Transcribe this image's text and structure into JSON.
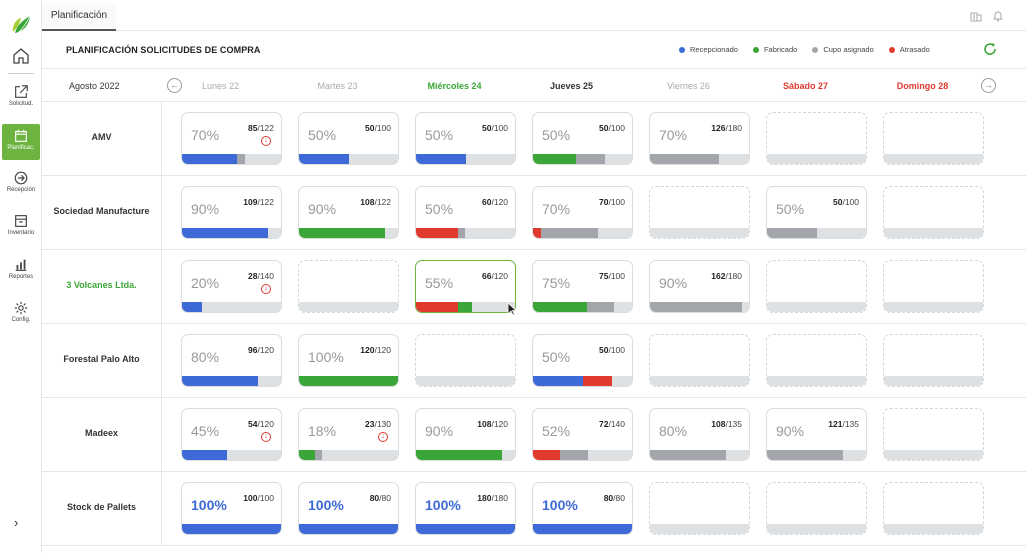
{
  "tab": "Planificación",
  "title": "PLANIFICACIÓN SOLICITUDES DE COMPRA",
  "legend": [
    {
      "label": "Recepcionado",
      "color": "#3d6ad6"
    },
    {
      "label": "Fabricado",
      "color": "#3aa637"
    },
    {
      "label": "Cupo asignado",
      "color": "#a2a6aa"
    },
    {
      "label": "Atrasado",
      "color": "#e03a2e"
    }
  ],
  "sidebar": [
    {
      "label": "Solicitud.",
      "icon": "external-link-icon",
      "active": false
    },
    {
      "label": "Planificac.",
      "icon": "calendar-icon",
      "active": true
    },
    {
      "label": "Recepción",
      "icon": "arrow-circle-icon",
      "active": false
    },
    {
      "label": "Inventario",
      "icon": "box-icon",
      "active": false
    },
    {
      "label": "Reportes",
      "icon": "bar-chart-icon",
      "active": false
    },
    {
      "label": "Config.",
      "icon": "gear-icon",
      "active": false
    }
  ],
  "month": "Agosto 2022",
  "days": [
    {
      "label": "Lunes 22",
      "color": "#aaaaaa",
      "bold": false
    },
    {
      "label": "Martes 23",
      "color": "#aaaaaa",
      "bold": false
    },
    {
      "label": "Miércoles 24",
      "color": "#3aa637",
      "bold": true
    },
    {
      "label": "Jueves 25",
      "color": "#333333",
      "bold": true
    },
    {
      "label": "Viernes 26",
      "color": "#aaaaaa",
      "bold": false
    },
    {
      "label": "Sábado 27",
      "color": "#e03a2e",
      "bold": true
    },
    {
      "label": "Domingo 28",
      "color": "#e03a2e",
      "bold": true
    }
  ],
  "rows": [
    {
      "name": "AMV",
      "highlight": false,
      "cells": [
        {
          "pct": "70%",
          "num": "85",
          "den": "122",
          "alert": true,
          "segs": [
            {
              "c": "blue",
              "w": 0.56
            },
            {
              "c": "gray",
              "w": 0.08
            }
          ]
        },
        {
          "pct": "50%",
          "num": "50",
          "den": "100",
          "alert": false,
          "segs": [
            {
              "c": "blue",
              "w": 0.5
            }
          ]
        },
        {
          "pct": "50%",
          "num": "50",
          "den": "100",
          "alert": false,
          "segs": [
            {
              "c": "blue",
              "w": 0.5
            }
          ]
        },
        {
          "pct": "50%",
          "num": "50",
          "den": "100",
          "alert": false,
          "segs": [
            {
              "c": "green",
              "w": 0.43
            },
            {
              "c": "gray",
              "w": 0.3
            }
          ]
        },
        {
          "pct": "70%",
          "num": "126",
          "den": "180",
          "alert": false,
          "segs": [
            {
              "c": "gray",
              "w": 0.7
            }
          ]
        },
        null,
        null
      ]
    },
    {
      "name": "Sociedad Manufacture",
      "highlight": false,
      "cells": [
        {
          "pct": "90%",
          "num": "109",
          "den": "122",
          "alert": false,
          "segs": [
            {
              "c": "blue",
              "w": 0.87
            }
          ]
        },
        {
          "pct": "90%",
          "num": "108",
          "den": "122",
          "alert": false,
          "segs": [
            {
              "c": "green",
              "w": 0.87
            }
          ]
        },
        {
          "pct": "50%",
          "num": "60",
          "den": "120",
          "alert": false,
          "segs": [
            {
              "c": "red",
              "w": 0.42
            },
            {
              "c": "gray",
              "w": 0.08
            }
          ]
        },
        {
          "pct": "70%",
          "num": "70",
          "den": "100",
          "alert": false,
          "segs": [
            {
              "c": "red",
              "w": 0.08
            },
            {
              "c": "gray",
              "w": 0.58
            }
          ]
        },
        null,
        {
          "pct": "50%",
          "num": "50",
          "den": "100",
          "alert": false,
          "segs": [
            {
              "c": "gray",
              "w": 0.5
            }
          ]
        },
        null
      ]
    },
    {
      "name": "3 Volcanes Ltda.",
      "highlight": true,
      "cells": [
        {
          "pct": "20%",
          "num": "28",
          "den": "140",
          "alert": true,
          "segs": [
            {
              "c": "blue",
              "w": 0.2
            }
          ]
        },
        null,
        {
          "pct": "55%",
          "num": "66",
          "den": "120",
          "alert": false,
          "selected": true,
          "segs": [
            {
              "c": "red",
              "w": 0.42
            },
            {
              "c": "green",
              "w": 0.15
            }
          ]
        },
        {
          "pct": "75%",
          "num": "75",
          "den": "100",
          "alert": false,
          "segs": [
            {
              "c": "green",
              "w": 0.55
            },
            {
              "c": "gray",
              "w": 0.27
            }
          ]
        },
        {
          "pct": "90%",
          "num": "162",
          "den": "180",
          "alert": false,
          "segs": [
            {
              "c": "gray",
              "w": 0.93
            }
          ]
        },
        null,
        null
      ]
    },
    {
      "name": "Forestal Palo Alto",
      "highlight": false,
      "cells": [
        {
          "pct": "80%",
          "num": "96",
          "den": "120",
          "alert": false,
          "segs": [
            {
              "c": "blue",
              "w": 0.77
            }
          ]
        },
        {
          "pct": "100%",
          "num": "120",
          "den": "120",
          "alert": false,
          "segs": [
            {
              "c": "green",
              "w": 1.0
            }
          ]
        },
        null,
        {
          "pct": "50%",
          "num": "50",
          "den": "100",
          "alert": false,
          "segs": [
            {
              "c": "blue",
              "w": 0.5
            },
            {
              "c": "red",
              "w": 0.3
            }
          ]
        },
        null,
        null,
        null
      ]
    },
    {
      "name": "Madeex",
      "highlight": false,
      "cells": [
        {
          "pct": "45%",
          "num": "54",
          "den": "120",
          "alert": true,
          "segs": [
            {
              "c": "blue",
              "w": 0.45
            }
          ]
        },
        {
          "pct": "18%",
          "num": "23",
          "den": "130",
          "alert": true,
          "segs": [
            {
              "c": "green",
              "w": 0.16
            },
            {
              "c": "gray",
              "w": 0.07
            }
          ]
        },
        {
          "pct": "90%",
          "num": "108",
          "den": "120",
          "alert": false,
          "segs": [
            {
              "c": "green",
              "w": 0.87
            }
          ]
        },
        {
          "pct": "52%",
          "num": "72",
          "den": "140",
          "alert": false,
          "segs": [
            {
              "c": "red",
              "w": 0.27
            },
            {
              "c": "gray",
              "w": 0.29
            }
          ]
        },
        {
          "pct": "80%",
          "num": "108",
          "den": "135",
          "alert": false,
          "segs": [
            {
              "c": "gray",
              "w": 0.77
            }
          ]
        },
        {
          "pct": "90%",
          "num": "121",
          "den": "135",
          "alert": false,
          "segs": [
            {
              "c": "gray",
              "w": 0.77
            }
          ]
        },
        null
      ]
    },
    {
      "name": "Stock de Pallets",
      "highlight": false,
      "cells": [
        {
          "pct": "100%",
          "num": "100",
          "den": "100",
          "alert": false,
          "full": true,
          "segs": [
            {
              "c": "blue",
              "w": 1.0
            }
          ]
        },
        {
          "pct": "100%",
          "num": "80",
          "den": "80",
          "alert": false,
          "full": true,
          "segs": [
            {
              "c": "blue",
              "w": 1.0
            }
          ]
        },
        {
          "pct": "100%",
          "num": "180",
          "den": "180",
          "alert": false,
          "full": true,
          "segs": [
            {
              "c": "blue",
              "w": 1.0
            }
          ]
        },
        {
          "pct": "100%",
          "num": "80",
          "den": "80",
          "alert": false,
          "full": true,
          "segs": [
            {
              "c": "blue",
              "w": 1.0
            }
          ]
        },
        null,
        null,
        null
      ]
    }
  ]
}
